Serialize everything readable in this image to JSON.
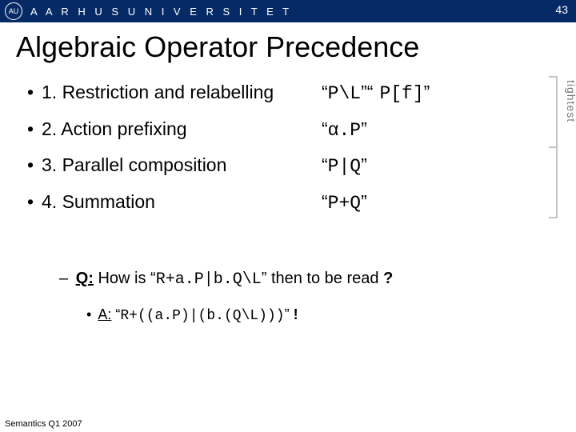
{
  "header": {
    "logo_initials": "AU",
    "university": "A A R H U S   U N I V E R S I T E T",
    "page_number": "43"
  },
  "title": "Algebraic Operator Precedence",
  "ops": [
    {
      "desc": "1. Restriction and relabelling",
      "ex1": "P\\L",
      "ex2": "P[f]"
    },
    {
      "desc": "2. Action prefixing",
      "ex1": "α.P",
      "ex2": ""
    },
    {
      "desc": "3. Parallel composition",
      "ex1": "P|Q",
      "ex2": ""
    },
    {
      "desc": "4. Summation",
      "ex1": "P+Q",
      "ex2": ""
    }
  ],
  "bracket_label": "tightest",
  "qa": {
    "q_label": "Q:",
    "q_text_pre": " How is “",
    "q_expr": "R+a.P|b.Q\\L",
    "q_text_post": "” then to be read ",
    "q_mark": "?",
    "a_label": "A:",
    "a_text_pre": " “",
    "a_expr": "R+((a.P)|(b.(Q\\L)))",
    "a_text_post": "” ",
    "a_mark": "!"
  },
  "footer": "Semantics Q1 2007"
}
